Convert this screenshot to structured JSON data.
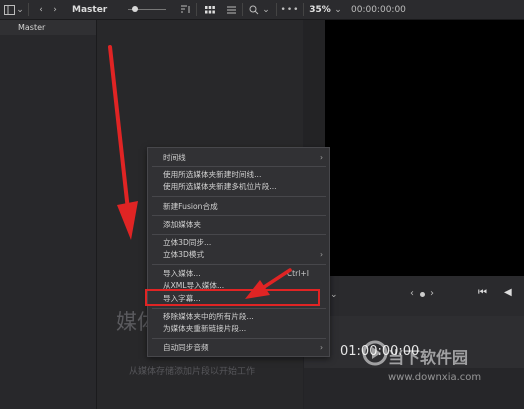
{
  "topbar": {
    "master_label": "Master",
    "zoom": "35%",
    "timecode": "00:00:00:00"
  },
  "sidebar": {
    "master": "Master"
  },
  "media_pool": {
    "empty_title": "媒体",
    "empty_hint": "从媒体存储添加片段以开始工作"
  },
  "viewer": {
    "timecode": "01:00:00:00"
  },
  "context_menu": {
    "items": [
      {
        "label": "时间线",
        "submenu": true
      },
      {
        "label": "使用所选媒体夹新建时间线..."
      },
      {
        "label": "使用所选媒体夹新建多机位片段..."
      },
      {
        "label": "新建Fusion合成"
      },
      {
        "label": "添加媒体夹"
      },
      {
        "label": "立体3D同步..."
      },
      {
        "label": "立体3D模式",
        "submenu": true
      },
      {
        "label": "导入媒体...",
        "shortcut": "Ctrl+I"
      },
      {
        "label": "从XML导入媒体..."
      },
      {
        "label": "导入字幕..."
      },
      {
        "label": "移除媒体夹中的所有片段..."
      },
      {
        "label": "为媒体夹重新链接片段..."
      },
      {
        "label": "自动同步音频",
        "submenu": true
      }
    ]
  },
  "watermark": {
    "line1": "当下软件园",
    "line2": "www.downxia.com"
  },
  "colors": {
    "annotation": "#e02424",
    "menu_bg": "#313134"
  }
}
